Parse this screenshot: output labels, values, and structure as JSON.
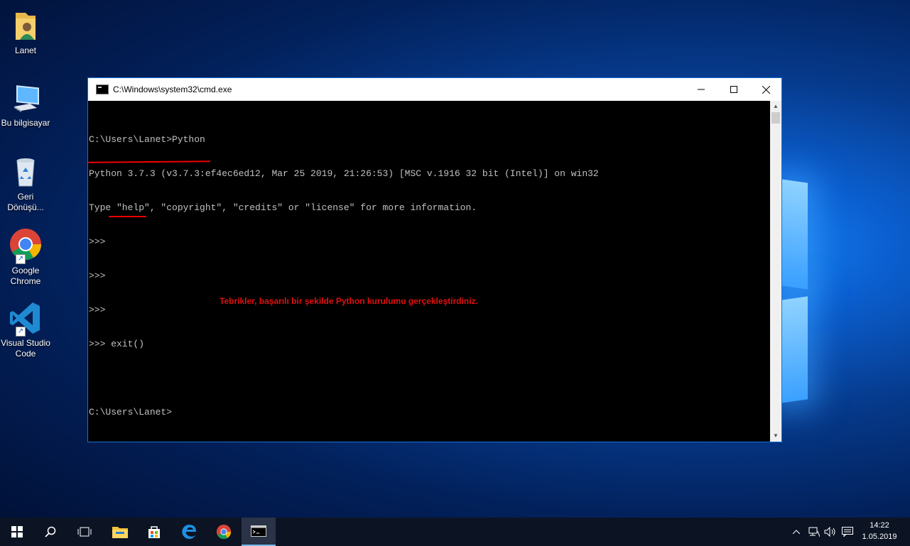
{
  "desktop": {
    "icons": [
      {
        "label": "Lanet"
      },
      {
        "label": "Bu bilgisayar"
      },
      {
        "label": "Geri Dönüşü..."
      },
      {
        "label": "Google Chrome"
      },
      {
        "label": "Visual Studio Code"
      }
    ]
  },
  "window": {
    "title": "C:\\Windows\\system32\\cmd.exe",
    "minimize_glyph": "—",
    "maximize_glyph": "☐",
    "close_glyph": "✕"
  },
  "console": {
    "lines": [
      "C:\\Users\\Lanet>Python",
      "Python 3.7.3 (v3.7.3:ef4ec6ed12, Mar 25 2019, 21:26:53) [MSC v.1916 32 bit (Intel)] on win32",
      "Type \"help\", \"copyright\", \"credits\" or \"license\" for more information.",
      ">>>",
      ">>>",
      ">>>",
      ">>> exit()",
      "",
      "C:\\Users\\Lanet>"
    ],
    "annotation": "Tebrikler, başarılı bir şekilde Python kurulumu gerçekleştirdiniz."
  },
  "taskbar": {
    "clock_time": "14:22",
    "clock_date": "1.05.2019"
  },
  "colors": {
    "accent": "#0078d7",
    "annotation_red": "#e21010",
    "console_text": "#c0c0c0"
  }
}
